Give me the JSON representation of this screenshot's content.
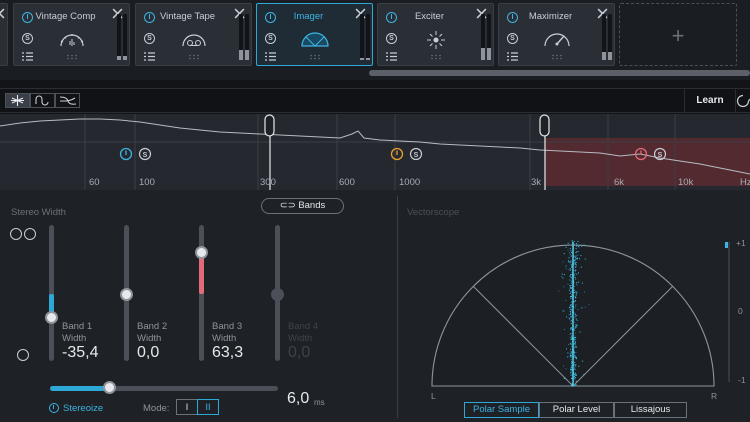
{
  "modules": [
    {
      "title": "",
      "state": "partial"
    },
    {
      "title": "Vintage Comp",
      "icon": "vintage-comp-icon"
    },
    {
      "title": "Vintage Tape",
      "icon": "vintage-tape-icon"
    },
    {
      "title": "Imager",
      "icon": "imager-icon",
      "active": true
    },
    {
      "title": "Exciter",
      "icon": "exciter-icon"
    },
    {
      "title": "Maximizer",
      "icon": "maximizer-icon"
    }
  ],
  "solo_label": "S",
  "add_module_label": "+",
  "toolbar": {
    "learn_label": "Learn",
    "view_buttons": [
      "width-view-icon",
      "band-view-icon",
      "spectrum-view-icon"
    ]
  },
  "spectrum": {
    "frequency_labels": [
      "60",
      "100",
      "300",
      "600",
      "1000",
      "3k",
      "6k",
      "10k",
      "Hz"
    ]
  },
  "stereo_width": {
    "label": "Stereo Width",
    "bands_button": "Bands",
    "width_word": "Width",
    "bands": [
      {
        "name": "Band 1",
        "value": "-35,4",
        "enabled": true
      },
      {
        "name": "Band 2",
        "value": "0,0",
        "enabled": true
      },
      {
        "name": "Band 3",
        "value": "63,3",
        "enabled": true
      },
      {
        "name": "Band 4",
        "value": "0,0",
        "enabled": false
      }
    ],
    "stereoize": {
      "label": "Stereoize",
      "mode_label": "Mode:",
      "modes": [
        "I",
        "II"
      ],
      "selected_mode": "II",
      "delay_value": "6,0",
      "delay_unit": "ms",
      "slider_fraction": 0.26
    }
  },
  "vectorscope": {
    "label": "Vectorscope",
    "left_label": "L",
    "right_label": "R",
    "scale_labels": [
      "+1",
      "0",
      "-1"
    ],
    "tabs": [
      "Polar Sample",
      "Polar Level",
      "Lissajous"
    ],
    "selected_tab": "Polar Sample"
  },
  "colors": {
    "accent": "#2ea8d6",
    "band3_fill": "#e56a78",
    "band4_region": "#5a2a30",
    "spectrum_line": "#b7bbc2"
  }
}
